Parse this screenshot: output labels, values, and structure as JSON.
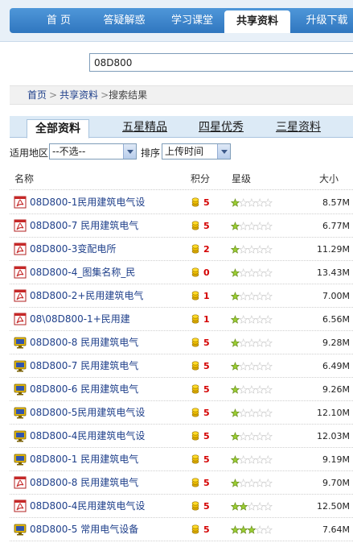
{
  "nav": {
    "tabs": [
      {
        "label": "首 页",
        "active": false
      },
      {
        "label": "答疑解惑",
        "active": false
      },
      {
        "label": "学习课堂",
        "active": false
      },
      {
        "label": "共享资料",
        "active": true
      },
      {
        "label": "升级下载",
        "active": false
      }
    ]
  },
  "search": {
    "value": "08D800"
  },
  "breadcrumb": {
    "home": "首页",
    "section": "共享资料",
    "current": "搜索结果",
    "separator": ">"
  },
  "filter_tabs": [
    {
      "label": "全部资料",
      "active": true
    },
    {
      "label": "五星精品",
      "active": false
    },
    {
      "label": "四星优秀",
      "active": false
    },
    {
      "label": "三星资料",
      "active": false
    }
  ],
  "filters": {
    "region_label": "适用地区",
    "region_value": "--不选--",
    "sort_label": "排序",
    "sort_value": "上传时间"
  },
  "table": {
    "headers": {
      "name": "名称",
      "points": "积分",
      "rating": "星级",
      "size": "大小"
    },
    "rows": [
      {
        "icon": "pdf-icon",
        "name": "08D800-1民用建筑电气设",
        "points": "5",
        "stars": 1,
        "size": "8.57M"
      },
      {
        "icon": "pdf-icon",
        "name": "08D800-7 民用建筑电气",
        "points": "5",
        "stars": 1,
        "size": "6.77M"
      },
      {
        "icon": "pdf-icon",
        "name": "08D800-3变配电所",
        "points": "2",
        "stars": 1,
        "size": "11.29M"
      },
      {
        "icon": "pdf-icon",
        "name": "08D800-4_图集名称_民",
        "points": "0",
        "stars": 1,
        "size": "13.43M"
      },
      {
        "icon": "pdf-icon",
        "name": "08D800-2+民用建筑电气",
        "points": "1",
        "stars": 1,
        "size": "7.00M"
      },
      {
        "icon": "pdf-icon",
        "name": "08\\08D800-1+民用建",
        "points": "1",
        "stars": 1,
        "size": "6.56M"
      },
      {
        "icon": "monitor-icon",
        "name": "08D800-8 民用建筑电气",
        "points": "5",
        "stars": 1,
        "size": "9.28M"
      },
      {
        "icon": "monitor-icon",
        "name": "08D800-7 民用建筑电气",
        "points": "5",
        "stars": 1,
        "size": "6.49M"
      },
      {
        "icon": "monitor-icon",
        "name": "08D800-6 民用建筑电气",
        "points": "5",
        "stars": 1,
        "size": "9.26M"
      },
      {
        "icon": "monitor-icon",
        "name": "08D800-5民用建筑电气设",
        "points": "5",
        "stars": 1,
        "size": "12.10M"
      },
      {
        "icon": "monitor-icon",
        "name": "08D800-4民用建筑电气设",
        "points": "5",
        "stars": 1,
        "size": "12.03M"
      },
      {
        "icon": "monitor-icon",
        "name": "08D800-1 民用建筑电气",
        "points": "5",
        "stars": 1,
        "size": "9.19M"
      },
      {
        "icon": "pdf-icon",
        "name": "08D800-8 民用建筑电气",
        "points": "5",
        "stars": 1,
        "size": "9.70M"
      },
      {
        "icon": "pdf-icon",
        "name": "08D800-4民用建筑电气设",
        "points": "5",
        "stars": 2,
        "size": "12.50M"
      },
      {
        "icon": "monitor-icon",
        "name": "08D800-5 常用电气设备",
        "points": "5",
        "stars": 3,
        "size": "7.64M"
      }
    ]
  },
  "colors": {
    "link": "#1e3f8a",
    "points": "#d40000",
    "nav": "#3a83cc",
    "star_on": "#9acd32",
    "star_off": "#dddddd"
  }
}
